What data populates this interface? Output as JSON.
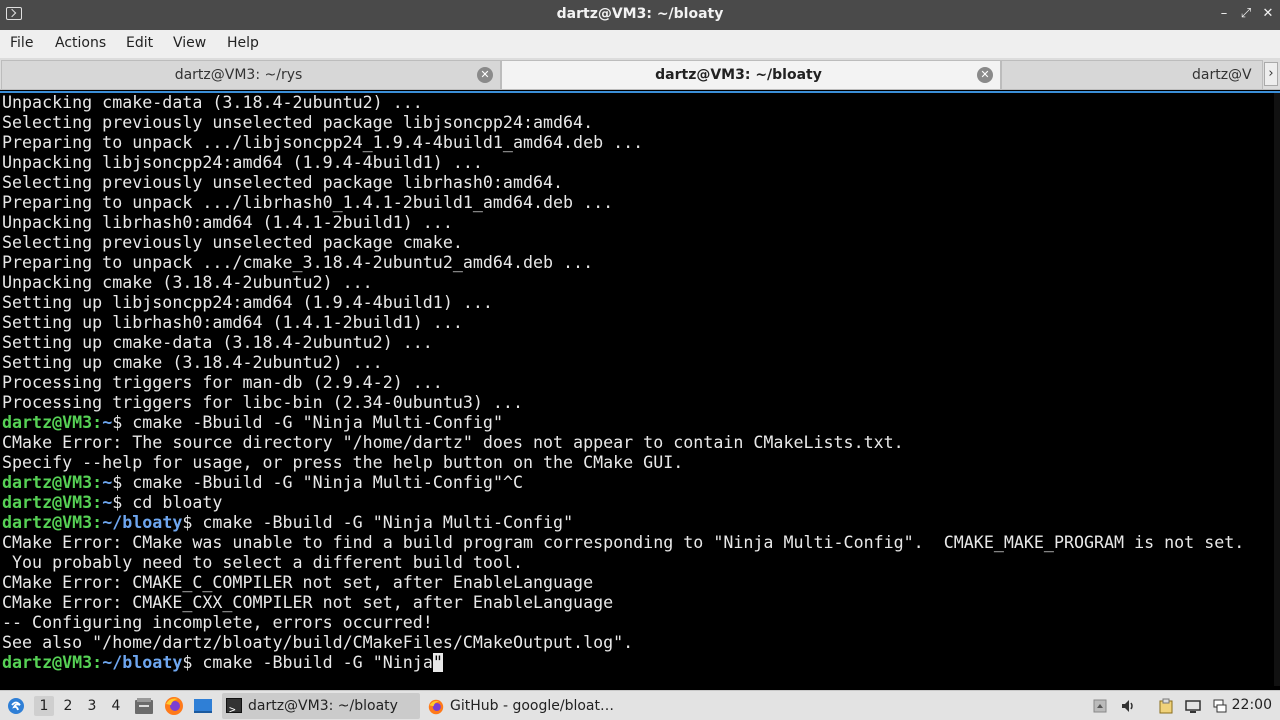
{
  "window": {
    "title": "dartz@VM3: ~/bloaty",
    "controls": {
      "minimize": "–",
      "restore": "⤢",
      "close": "✕"
    }
  },
  "menubar": {
    "items": [
      "File",
      "Actions",
      "Edit",
      "View",
      "Help"
    ]
  },
  "tabs": [
    {
      "label": "dartz@VM3: ~/rys",
      "active": false
    },
    {
      "label": "dartz@VM3: ~/bloaty",
      "active": true
    },
    {
      "label": "dartz@V",
      "active": false
    }
  ],
  "terminal": {
    "lines": [
      {
        "text": "Unpacking cmake-data (3.18.4-2ubuntu2) ..."
      },
      {
        "text": "Selecting previously unselected package libjsoncpp24:amd64."
      },
      {
        "text": "Preparing to unpack .../libjsoncpp24_1.9.4-4build1_amd64.deb ..."
      },
      {
        "text": "Unpacking libjsoncpp24:amd64 (1.9.4-4build1) ..."
      },
      {
        "text": "Selecting previously unselected package librhash0:amd64."
      },
      {
        "text": "Preparing to unpack .../librhash0_1.4.1-2build1_amd64.deb ..."
      },
      {
        "text": "Unpacking librhash0:amd64 (1.4.1-2build1) ..."
      },
      {
        "text": "Selecting previously unselected package cmake."
      },
      {
        "text": "Preparing to unpack .../cmake_3.18.4-2ubuntu2_amd64.deb ..."
      },
      {
        "text": "Unpacking cmake (3.18.4-2ubuntu2) ..."
      },
      {
        "text": "Setting up libjsoncpp24:amd64 (1.9.4-4build1) ..."
      },
      {
        "text": "Setting up librhash0:amd64 (1.4.1-2build1) ..."
      },
      {
        "text": "Setting up cmake-data (3.18.4-2ubuntu2) ..."
      },
      {
        "text": "Setting up cmake (3.18.4-2ubuntu2) ..."
      },
      {
        "text": "Processing triggers for man-db (2.9.4-2) ..."
      },
      {
        "text": "Processing triggers for libc-bin (2.34-0ubuntu3) ..."
      },
      {
        "user": "dartz@VM3",
        "path": "~",
        "cmd": " cmake -Bbuild -G \"Ninja Multi-Config\""
      },
      {
        "text": "CMake Error: The source directory \"/home/dartz\" does not appear to contain CMakeLists.txt."
      },
      {
        "text": "Specify --help for usage, or press the help button on the CMake GUI."
      },
      {
        "user": "dartz@VM3",
        "path": "~",
        "cmd": " cmake -Bbuild -G \"Ninja Multi-Config\"^C"
      },
      {
        "user": "dartz@VM3",
        "path": "~",
        "cmd": " cd bloaty"
      },
      {
        "user": "dartz@VM3",
        "path": "~/bloaty",
        "cmd": " cmake -Bbuild -G \"Ninja Multi-Config\""
      },
      {
        "text": "CMake Error: CMake was unable to find a build program corresponding to \"Ninja Multi-Config\".  CMAKE_MAKE_PROGRAM is not set."
      },
      {
        "text": " You probably need to select a different build tool."
      },
      {
        "text": "CMake Error: CMAKE_C_COMPILER not set, after EnableLanguage"
      },
      {
        "text": "CMake Error: CMAKE_CXX_COMPILER not set, after EnableLanguage"
      },
      {
        "text": "-- Configuring incomplete, errors occurred!"
      },
      {
        "text": "See also \"/home/dartz/bloaty/build/CMakeFiles/CMakeOutput.log\"."
      },
      {
        "user": "dartz@VM3",
        "path": "~/bloaty",
        "cmd": " cmake -Bbuild -G \"Ninja",
        "cursor": "\""
      }
    ]
  },
  "taskbar": {
    "workspaces": [
      "1",
      "2",
      "3",
      "4"
    ],
    "active_workspace": "1",
    "tasks": [
      {
        "label": "dartz@VM3: ~/bloaty",
        "icon": "terminal-icon",
        "active": true
      },
      {
        "label": "GitHub - google/bloat…",
        "icon": "firefox-icon",
        "active": false
      }
    ],
    "clock": "22:00"
  },
  "colors": {
    "prompt_user": "#56d255",
    "prompt_path": "#6ea6ef",
    "terminal_bg": "#000000",
    "terminal_fg": "#e8e8e8",
    "active_border": "#3b8fd9"
  }
}
